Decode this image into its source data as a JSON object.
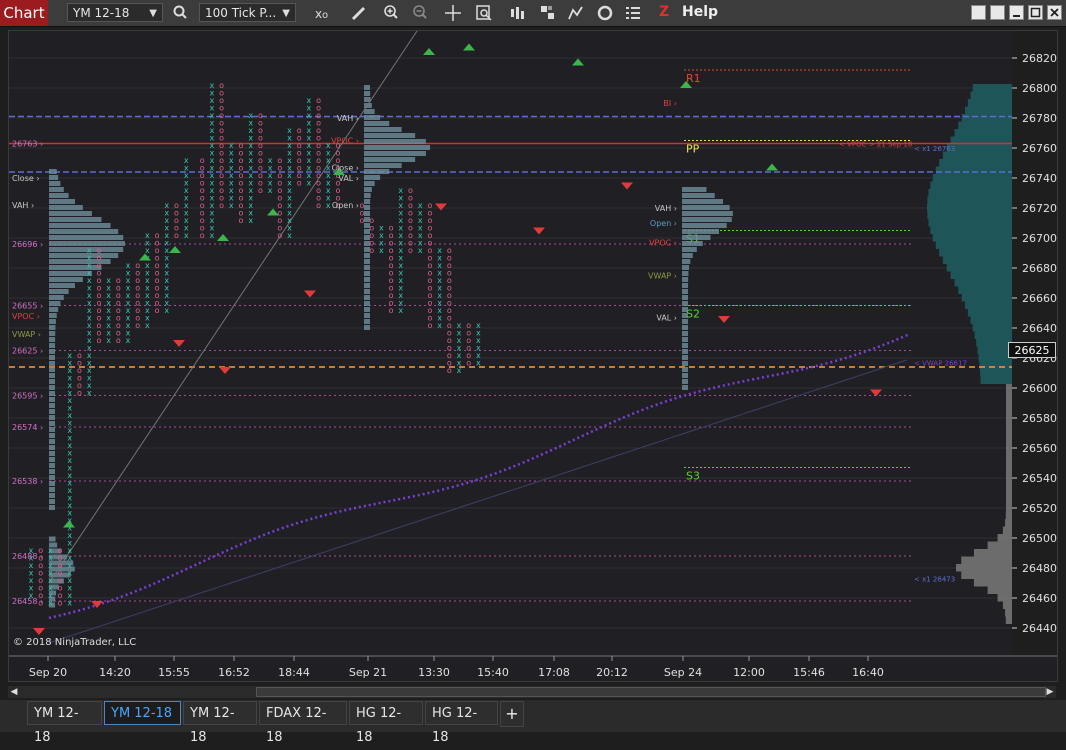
{
  "toolbar": {
    "chart_label": "Chart",
    "instrument": "YM 12-18",
    "bar_type": "100 Tick P...",
    "help": "Help",
    "z_label": "Z",
    "icons": [
      "search-icon",
      "clear-icon",
      "pencil-icon",
      "zoom-in-icon",
      "zoom-out-icon",
      "crosshair-icon",
      "data-box-icon",
      "bar-type-icon",
      "strategy-icon",
      "indicator-icon",
      "refresh-icon",
      "properties-icon"
    ]
  },
  "chart": {
    "current_price": "26625",
    "copyright": "© 2018 NinjaTrader, LLC",
    "price_ticks": [
      "26820",
      "26800",
      "26780",
      "26760",
      "26740",
      "26720",
      "26700",
      "26680",
      "26660",
      "26640",
      "26620",
      "26600",
      "26580",
      "26560",
      "26540",
      "26520",
      "26500",
      "26480",
      "26460",
      "26440"
    ],
    "time_labels": [
      "Sep 20",
      "14:20",
      "15:55",
      "16:52",
      "18:44",
      "Sep 21",
      "13:30",
      "15:40",
      "17:08",
      "20:12",
      "Sep 24",
      "12:00",
      "15:46",
      "16:40"
    ],
    "pivot_labels": [
      "R1",
      "PP",
      "S1",
      "S2",
      "S3"
    ],
    "left_levels": [
      "26763",
      "Close",
      "VAH",
      "26696",
      "26655",
      "VPOC",
      "VWAP",
      "26625",
      "26595",
      "26574",
      "26538",
      "26488",
      "26458"
    ],
    "mid1_labels": [
      "VAH",
      "VPOC",
      "Close",
      "VAL",
      "Open"
    ],
    "mid2_labels": [
      "BI",
      "VAH",
      "Open",
      "VPOC",
      "VWAP",
      "VAL"
    ],
    "right_notes": [
      "< VPOC > 21 Sep 18",
      "< x1 26763",
      "< VWAP 26617",
      "< x1 26473"
    ],
    "colors": {
      "bg": "#202024",
      "up": "#33c7b5",
      "down": "#e0608a",
      "grid": "#2e2e34",
      "vwap": "#7a3fd6",
      "pivot_r": "#e04a2a",
      "pivot_pp": "#e8e84a",
      "pivot_s": "#5ad22c",
      "current": "#ff9a3a"
    }
  },
  "tabs": [
    "YM 12-18",
    "YM 12-18",
    "YM 12-18",
    "FDAX 12-18",
    "HG 12-18",
    "HG 12-18"
  ],
  "active_tab": 1,
  "add_tab": "+"
}
